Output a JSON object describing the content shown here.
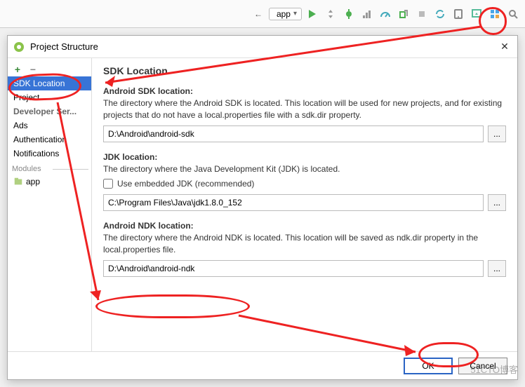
{
  "toolbar": {
    "app_label": "app"
  },
  "dialog": {
    "title": "Project Structure"
  },
  "sidebar": {
    "items": [
      "SDK Location",
      "Project",
      "Developer Ser...",
      "Ads",
      "Authentication",
      "Notifications"
    ],
    "modules_label": "Modules",
    "module_app": "app"
  },
  "main": {
    "heading": "SDK Location",
    "sdk": {
      "label": "Android SDK location:",
      "desc": "The directory where the Android SDK is located. This location will be used for new projects, and for existing projects that do not have a local.properties file with a sdk.dir property.",
      "value": "D:\\Android\\android-sdk"
    },
    "jdk": {
      "label": "JDK location:",
      "desc": "The directory where the Java Development Kit (JDK) is located.",
      "embedded_label": "Use embedded JDK (recommended)",
      "value": "C:\\Program Files\\Java\\jdk1.8.0_152"
    },
    "ndk": {
      "label": "Android NDK location:",
      "desc": "The directory where the Android NDK is located. This location will be saved as ndk.dir property in the local.properties file.",
      "value": "D:\\Android\\android-ndk"
    },
    "browse_label": "..."
  },
  "footer": {
    "ok": "OK",
    "cancel": "Cancel"
  },
  "watermark": "51CTO博客"
}
